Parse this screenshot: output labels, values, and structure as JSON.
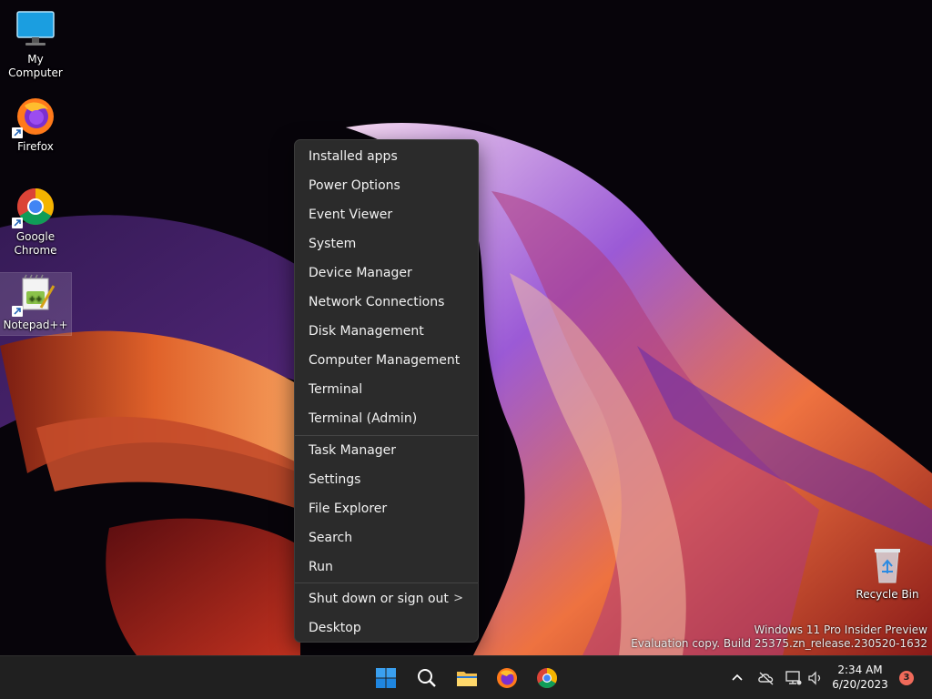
{
  "desktop": {
    "icons": [
      {
        "label": "My Computer",
        "icon": "monitor-icon"
      },
      {
        "label": "Firefox",
        "icon": "firefox-icon"
      },
      {
        "label": "Google Chrome",
        "icon": "chrome-icon"
      },
      {
        "label": "Notepad++",
        "icon": "notepad-plus-plus-icon"
      }
    ],
    "recycle_bin": {
      "label": "Recycle Bin",
      "icon": "recycle-bin-icon"
    }
  },
  "context_menu": {
    "groups": [
      [
        "Installed apps",
        "Power Options",
        "Event Viewer",
        "System",
        "Device Manager",
        "Network Connections",
        "Disk Management",
        "Computer Management",
        "Terminal",
        "Terminal (Admin)"
      ],
      [
        "Task Manager",
        "Settings",
        "File Explorer",
        "Search",
        "Run"
      ],
      [
        "Shut down or sign out",
        "Desktop"
      ]
    ],
    "submenu_chevron": ">"
  },
  "watermark": {
    "line1": "Windows 11 Pro Insider Preview",
    "line2": "Evaluation copy. Build 25375.zn_release.230520-1632"
  },
  "taskbar": {
    "pinned": [
      "start-icon",
      "search-icon",
      "file-explorer-icon",
      "firefox-icon",
      "chrome-icon"
    ],
    "tray": {
      "icons": [
        "chevron-up-icon",
        "onedrive-icon",
        "network-icon",
        "volume-icon"
      ],
      "time": "2:34 AM",
      "date": "6/20/2023",
      "notification_count": "3"
    }
  },
  "colors": {
    "menu_bg": "#2b2b2b",
    "taskbar_bg": "#202020",
    "accent": "#0a84ff",
    "badge": "#f06a5a"
  }
}
